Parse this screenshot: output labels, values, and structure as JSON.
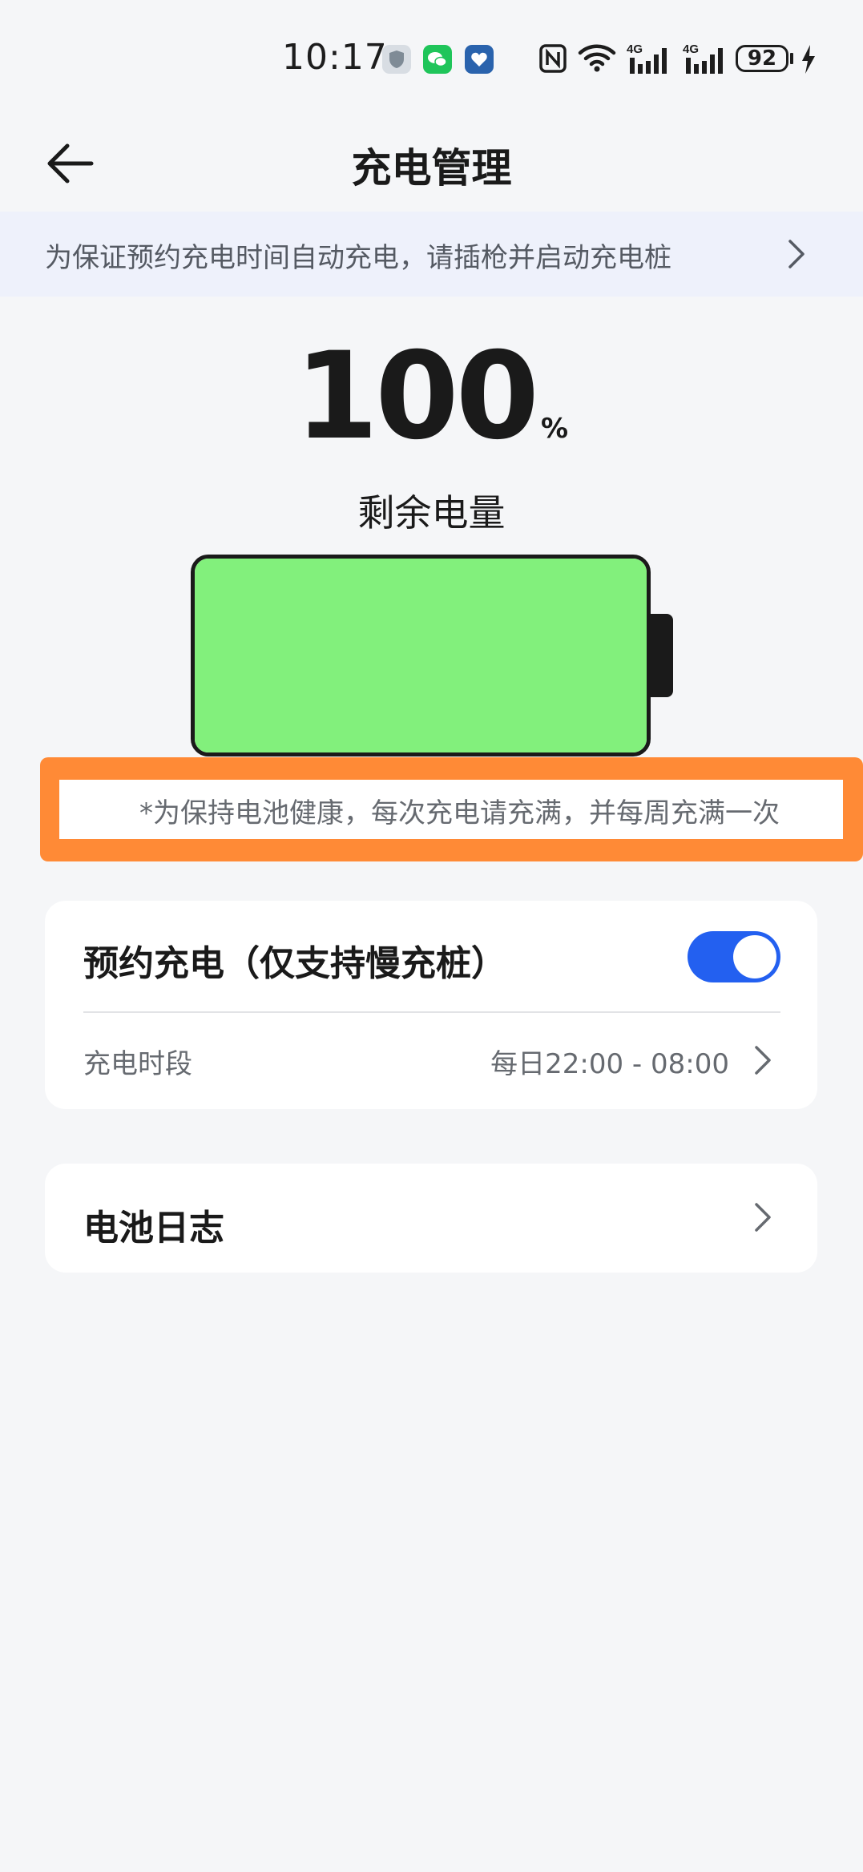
{
  "status_bar": {
    "time": "10:17",
    "battery_level": "92",
    "network_1": "4G",
    "network_2": "4G",
    "icons": [
      "shield-icon",
      "wechat-icon",
      "heart-icon",
      "nfc-icon",
      "wifi-icon",
      "signal-icon",
      "signal-icon",
      "battery-icon",
      "charging-icon"
    ]
  },
  "header": {
    "title": "充电管理",
    "back_icon": "arrow-left-icon"
  },
  "notice": {
    "text": "为保证预约充电时间自动充电，请插枪并启动充电桩",
    "icon": "chevron-right-icon"
  },
  "battery": {
    "percent": "100",
    "unit": "%",
    "label": "剩余电量",
    "level_fraction": 1.0,
    "fill_color": "#82f07c"
  },
  "tip": {
    "text": "*为保持电池健康，每次充电请充满，并每周充满一次",
    "highlight_color": "#ff8a36"
  },
  "schedule_card": {
    "title": "预约充电（仅支持慢充桩）",
    "toggle_on": true,
    "toggle_color": "#2360f0",
    "period_label": "充电时段",
    "period_value": "每日22:00 - 08:00"
  },
  "log_card": {
    "title": "电池日志"
  }
}
